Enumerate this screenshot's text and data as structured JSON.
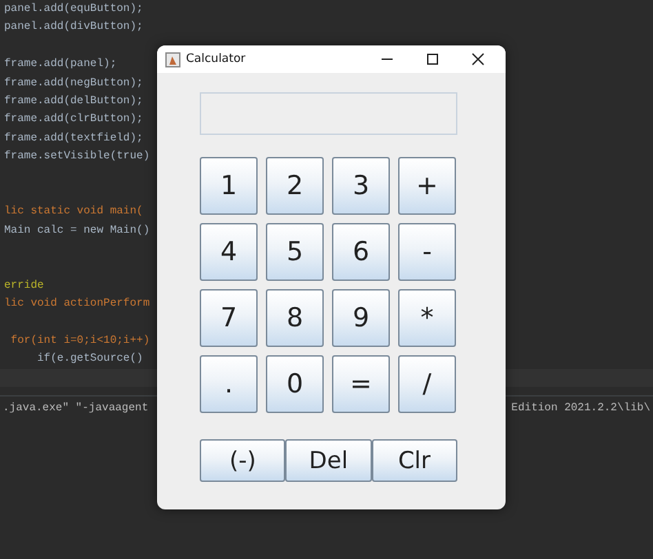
{
  "editor": {
    "lines": [
      {
        "text": "panel.add(equButton);",
        "kind": "statement",
        "current": false
      },
      {
        "text": "panel.add(divButton);",
        "kind": "statement",
        "current": false
      },
      {
        "current": false
      },
      {
        "text": "frame.add(panel);",
        "kind": "statement",
        "current": false
      },
      {
        "text": "frame.add(negButton);",
        "kind": "statement",
        "current": false
      },
      {
        "text": "frame.add(delButton);",
        "kind": "statement",
        "current": false
      },
      {
        "text": "frame.add(clrButton);",
        "kind": "statement",
        "current": false
      },
      {
        "text": "frame.add(textfield);",
        "kind": "statement",
        "current": false
      },
      {
        "text": "frame.setVisible(true)",
        "kind": "statement",
        "current": false
      },
      {
        "current": false
      },
      {
        "current": false
      },
      {
        "text": "lic static void main(",
        "kind": "keyword",
        "current": false
      },
      {
        "text": "Main calc = new Main()",
        "kind": "statement",
        "current": false
      },
      {
        "current": false
      },
      {
        "current": false
      },
      {
        "text": "erride",
        "kind": "annotation",
        "current": false
      },
      {
        "text": "lic void actionPerform",
        "kind": "keyword",
        "current": false
      },
      {
        "current": false
      },
      {
        "text": " for(int i=0;i<10;i++)",
        "kind": "keyword",
        "current": false
      },
      {
        "text": "     if(e.getSource()",
        "kind": "statement",
        "current": false
      },
      {
        "current": true
      }
    ]
  },
  "console": {
    "left": ".java.exe\" \"-javaagent",
    "right": "Edition 2021.2.2\\lib\\"
  },
  "calculator": {
    "title": "Calculator",
    "keys": [
      "1",
      "2",
      "3",
      "+",
      "4",
      "5",
      "6",
      "-",
      "7",
      "8",
      "9",
      "*",
      ".",
      "0",
      "=",
      "/"
    ],
    "function_keys": [
      "(-)",
      "Del",
      "Clr"
    ]
  }
}
